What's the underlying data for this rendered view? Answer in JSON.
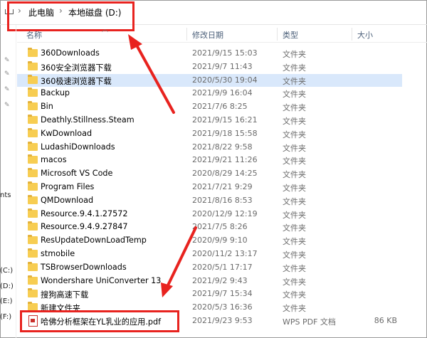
{
  "address_bar": {
    "breadcrumbs": [
      "此电脑",
      "本地磁盘 (D:)"
    ],
    "separator": "›"
  },
  "columns": {
    "name": "名称",
    "date": "修改日期",
    "type": "类型",
    "size": "大小"
  },
  "left_pane": {
    "texts": [
      "nts",
      "(C:)",
      "(D:)",
      "(E:)",
      "(F:)"
    ],
    "icon": "pin-icon"
  },
  "rows": [
    {
      "name": "360Downloads",
      "date": "2021/9/15 15:03",
      "type": "文件夹",
      "size": "",
      "icon": "folder-icon"
    },
    {
      "name": "360安全浏览器下载",
      "date": "2021/9/7 11:43",
      "type": "文件夹",
      "size": "",
      "icon": "folder-icon"
    },
    {
      "name": "360极速浏览器下载",
      "date": "2020/5/30 19:04",
      "type": "文件夹",
      "size": "",
      "icon": "folder-icon",
      "selected": true
    },
    {
      "name": "Backup",
      "date": "2021/9/9 16:04",
      "type": "文件夹",
      "size": "",
      "icon": "folder-icon"
    },
    {
      "name": "Bin",
      "date": "2021/7/6 8:25",
      "type": "文件夹",
      "size": "",
      "icon": "folder-icon"
    },
    {
      "name": "Deathly.Stillness.Steam",
      "date": "2021/9/15 16:21",
      "type": "文件夹",
      "size": "",
      "icon": "folder-icon"
    },
    {
      "name": "KwDownload",
      "date": "2021/9/18 15:58",
      "type": "文件夹",
      "size": "",
      "icon": "folder-icon"
    },
    {
      "name": "LudashiDownloads",
      "date": "2021/8/22 9:58",
      "type": "文件夹",
      "size": "",
      "icon": "folder-icon"
    },
    {
      "name": "macos",
      "date": "2021/9/21 11:26",
      "type": "文件夹",
      "size": "",
      "icon": "folder-icon"
    },
    {
      "name": "Microsoft VS Code",
      "date": "2020/8/29 14:25",
      "type": "文件夹",
      "size": "",
      "icon": "folder-icon"
    },
    {
      "name": "Program Files",
      "date": "2021/7/21 9:29",
      "type": "文件夹",
      "size": "",
      "icon": "folder-icon"
    },
    {
      "name": "QMDownload",
      "date": "2021/8/16 8:53",
      "type": "文件夹",
      "size": "",
      "icon": "folder-icon"
    },
    {
      "name": "Resource.9.4.1.27572",
      "date": "2020/12/9 12:19",
      "type": "文件夹",
      "size": "",
      "icon": "folder-icon"
    },
    {
      "name": "Resource.9.4.9.27847",
      "date": "2021/7/5 8:26",
      "type": "文件夹",
      "size": "",
      "icon": "folder-icon"
    },
    {
      "name": "ResUpdateDownLoadTemp",
      "date": "2020/9/9 9:10",
      "type": "文件夹",
      "size": "",
      "icon": "folder-icon"
    },
    {
      "name": "stmobile",
      "date": "2020/11/2 13:17",
      "type": "文件夹",
      "size": "",
      "icon": "folder-icon"
    },
    {
      "name": "TSBrowserDownloads",
      "date": "2020/5/1 17:17",
      "type": "文件夹",
      "size": "",
      "icon": "folder-icon"
    },
    {
      "name": "Wondershare UniConverter 13",
      "date": "2021/9/2 9:43",
      "type": "文件夹",
      "size": "",
      "icon": "folder-icon"
    },
    {
      "name": "搜狗高速下载",
      "date": "2021/9/7 15:34",
      "type": "文件夹",
      "size": "",
      "icon": "folder-icon"
    },
    {
      "name": "新建文件夹",
      "date": "2020/5/3 16:36",
      "type": "文件夹",
      "size": "",
      "icon": "folder-icon"
    },
    {
      "name": "哈佛分析框架在YL乳业的应用.pdf",
      "date": "2021/9/23 9:53",
      "type": "WPS PDF 文档",
      "size": "86 KB",
      "icon": "pdf-icon"
    }
  ],
  "colors": {
    "highlight": "#e8231f",
    "selected_row": "#d9e8fb",
    "folder": "#f7cd52",
    "header_text": "#4c607a"
  }
}
